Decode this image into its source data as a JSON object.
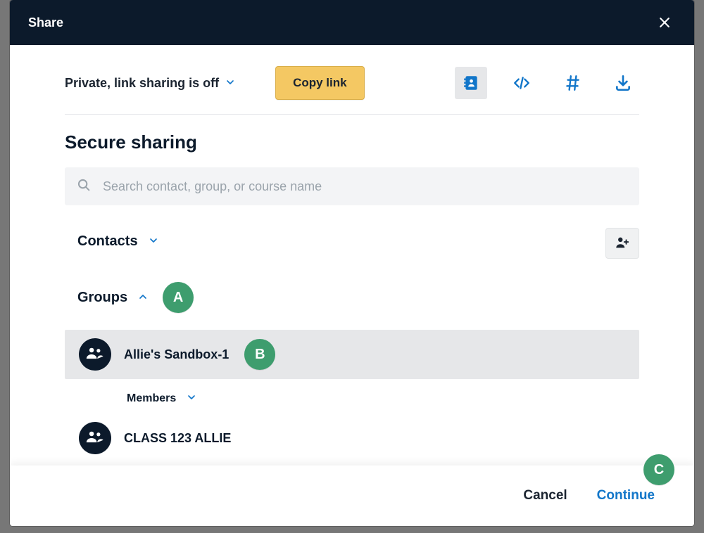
{
  "header": {
    "title": "Share"
  },
  "top": {
    "privacy_label": "Private, link sharing is off",
    "copy_link_label": "Copy link"
  },
  "section": {
    "title": "Secure sharing"
  },
  "search": {
    "placeholder": "Search contact, group, or course name"
  },
  "contacts": {
    "label": "Contacts"
  },
  "groups": {
    "label": "Groups",
    "items": [
      {
        "name": "Allie's Sandbox-1",
        "members_label": "Members"
      },
      {
        "name": "CLASS 123 ALLIE"
      }
    ]
  },
  "footer": {
    "cancel": "Cancel",
    "continue": "Continue"
  },
  "annotations": {
    "a": "A",
    "b": "B",
    "c": "C"
  }
}
